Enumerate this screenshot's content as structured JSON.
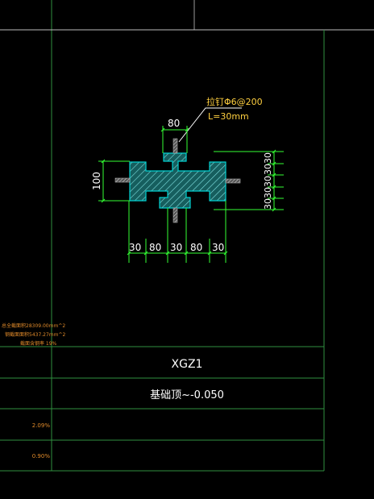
{
  "drawing": {
    "callout_rebar": "拉钉Φ6@200",
    "callout_length": "L=30mm",
    "dim_top": "80",
    "dim_left": "100",
    "dim_bottom": [
      "30",
      "80",
      "30",
      "80",
      "30"
    ],
    "dim_right": [
      "30",
      "30",
      "30",
      "30",
      "30"
    ]
  },
  "side_notes": {
    "line1": "总全截面积28309.00mm^2",
    "line2": "钢截面面积5437.27mm^2",
    "line3": "截面含钢率 19%"
  },
  "table": {
    "name": "XGZ1",
    "elevation": "基础顶~-0.050",
    "ratio1": "2.09%",
    "ratio2": "0.90%"
  },
  "colors": {
    "background": "#000000",
    "frame_line": "#2f8f3f",
    "white_line": "#ffffff",
    "dimension": "#33ff33",
    "hatch_fill": "#2b8f8f",
    "steel_outline": "#00d0d0",
    "stud": "#c0c0c0",
    "note_text": "#e08a2a",
    "callout_text": "#ffd040",
    "table_text": "#ffffff"
  }
}
